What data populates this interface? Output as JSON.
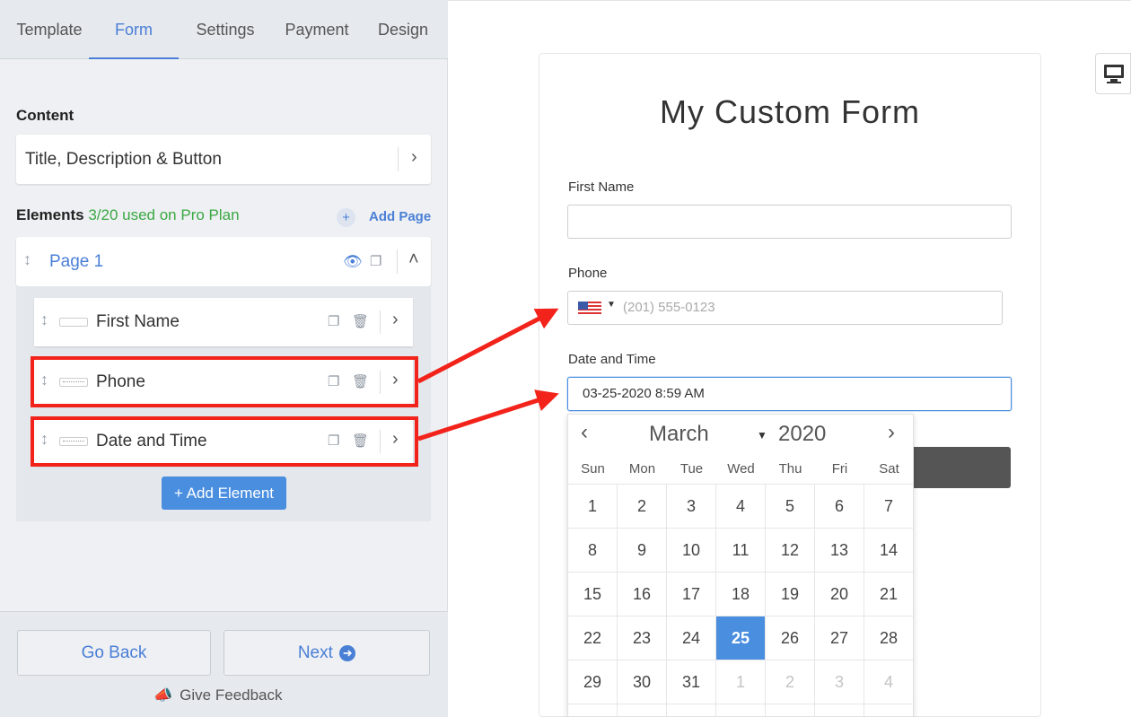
{
  "tabs": [
    {
      "label": "Template"
    },
    {
      "label": "Form"
    },
    {
      "label": "Settings"
    },
    {
      "label": "Payment"
    },
    {
      "label": "Design"
    }
  ],
  "active_tab": "Form",
  "content": {
    "section_label": "Content",
    "item_label": "Title, Description & Button"
  },
  "elements": {
    "label": "Elements",
    "usage": "3/20 used on Pro Plan",
    "add_page_label": "Add Page",
    "page_label": "Page 1",
    "items": [
      {
        "label": "First Name",
        "icon": "text-field-icon"
      },
      {
        "label": "Phone",
        "icon": "phone-field-icon"
      },
      {
        "label": "Date and Time",
        "icon": "date-field-icon"
      }
    ],
    "add_element_label": "+ Add Element"
  },
  "footer": {
    "back_label": "Go Back",
    "next_label": "Next",
    "feedback_label": "Give Feedback"
  },
  "preview": {
    "title": "My Custom Form",
    "fields": {
      "first_name_label": "First Name",
      "first_name_value": "",
      "phone_label": "Phone",
      "phone_placeholder": "(201) 555-0123",
      "phone_country": "US",
      "datetime_label": "Date and Time",
      "datetime_value": "03-25-2020 8:59 AM"
    },
    "calendar": {
      "month": "March",
      "year": "2020",
      "prev_glyph": "‹",
      "next_glyph": "›",
      "weekdays": [
        "Sun",
        "Mon",
        "Tue",
        "Wed",
        "Thu",
        "Fri",
        "Sat"
      ],
      "weeks": [
        [
          "1",
          "2",
          "3",
          "4",
          "5",
          "6",
          "7"
        ],
        [
          "8",
          "9",
          "10",
          "11",
          "12",
          "13",
          "14"
        ],
        [
          "15",
          "16",
          "17",
          "18",
          "19",
          "20",
          "21"
        ],
        [
          "22",
          "23",
          "24",
          "25",
          "26",
          "27",
          "28"
        ],
        [
          "29",
          "30",
          "31",
          "1",
          "2",
          "3",
          "4"
        ]
      ],
      "selected_day": "25",
      "muted_last_row_from": 3
    }
  },
  "colors": {
    "accent": "#4a7fd6",
    "highlight": "#f2231a",
    "success": "#3aa843",
    "selected_day": "#4a8ee0"
  }
}
